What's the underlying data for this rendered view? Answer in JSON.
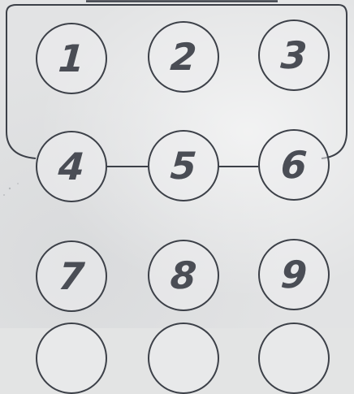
{
  "keypad": {
    "keys": [
      {
        "label": "1"
      },
      {
        "label": "2"
      },
      {
        "label": "3"
      },
      {
        "label": "4"
      },
      {
        "label": "5"
      },
      {
        "label": "6"
      },
      {
        "label": "7"
      },
      {
        "label": "8"
      },
      {
        "label": "9"
      }
    ]
  },
  "colors": {
    "paper": "#e2e3e4",
    "ink": "#3c4048",
    "digit": "#4a4d55"
  }
}
